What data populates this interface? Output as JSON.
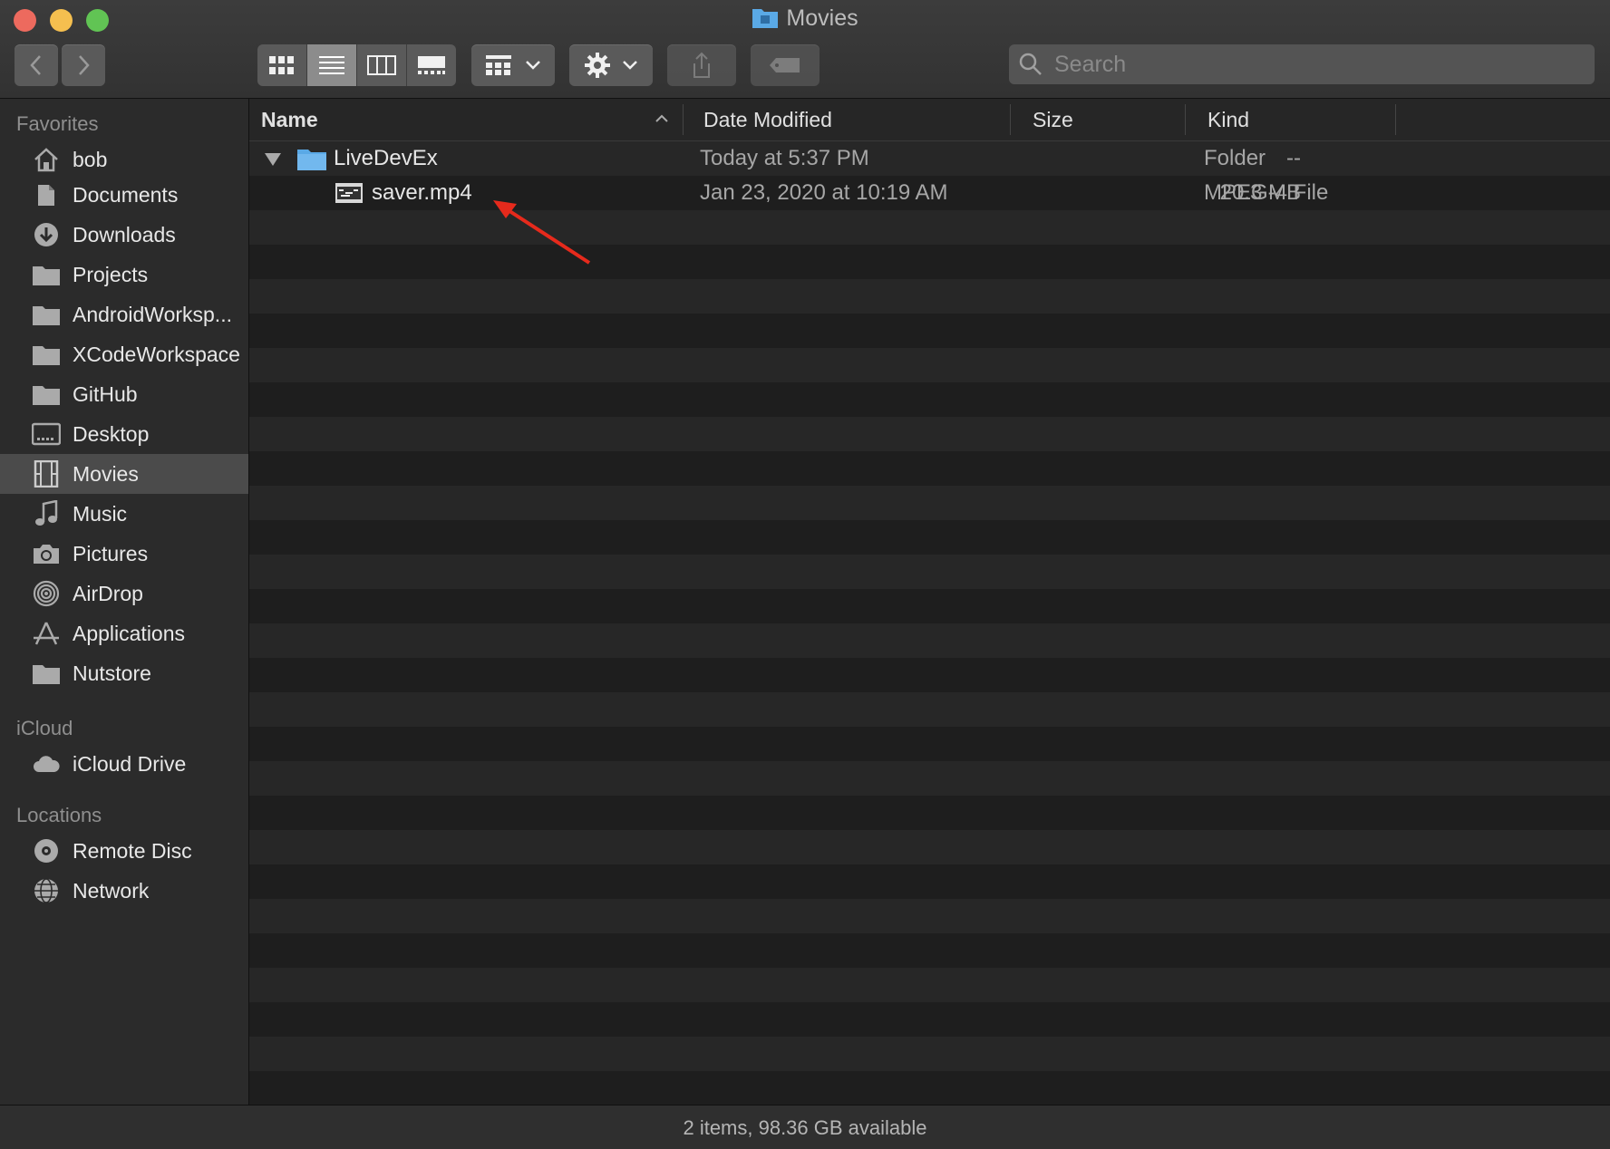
{
  "window": {
    "title": "Movies"
  },
  "toolbar": {
    "search_placeholder": "Search"
  },
  "sidebar": {
    "sections": [
      {
        "title": "Favorites",
        "items": [
          {
            "label": "bob",
            "icon": "home-icon"
          },
          {
            "label": "Documents",
            "icon": "documents-icon"
          },
          {
            "label": "Downloads",
            "icon": "downloads-icon"
          },
          {
            "label": "Projects",
            "icon": "folder-icon"
          },
          {
            "label": "AndroidWorksp...",
            "icon": "folder-icon"
          },
          {
            "label": "XCodeWorkspace",
            "icon": "folder-icon"
          },
          {
            "label": "GitHub",
            "icon": "folder-icon"
          },
          {
            "label": "Desktop",
            "icon": "desktop-icon"
          },
          {
            "label": "Movies",
            "icon": "movies-icon",
            "selected": true
          },
          {
            "label": "Music",
            "icon": "music-icon"
          },
          {
            "label": "Pictures",
            "icon": "camera-icon"
          },
          {
            "label": "AirDrop",
            "icon": "airdrop-icon"
          },
          {
            "label": "Applications",
            "icon": "applications-icon"
          },
          {
            "label": "Nutstore",
            "icon": "folder-icon"
          }
        ]
      },
      {
        "title": "iCloud",
        "items": [
          {
            "label": "iCloud Drive",
            "icon": "cloud-icon"
          }
        ]
      },
      {
        "title": "Locations",
        "items": [
          {
            "label": "Remote Disc",
            "icon": "disc-icon"
          },
          {
            "label": "Network",
            "icon": "network-icon"
          }
        ]
      }
    ]
  },
  "list": {
    "columns": {
      "name": "Name",
      "date": "Date Modified",
      "size": "Size",
      "kind": "Kind"
    },
    "rows": [
      {
        "name": "LiveDevEx",
        "date": "Today at 5:37 PM",
        "size": "--",
        "kind": "Folder"
      },
      {
        "name": "saver.mp4",
        "date": "Jan 23, 2020 at 10:19 AM",
        "size": "20.3 MB",
        "kind": "MPEG-4 File"
      }
    ]
  },
  "status": {
    "text": "2 items, 98.36 GB available"
  },
  "colors": {
    "accent_folder": "#5aa9e6",
    "annotation_arrow": "#e62a1c"
  }
}
